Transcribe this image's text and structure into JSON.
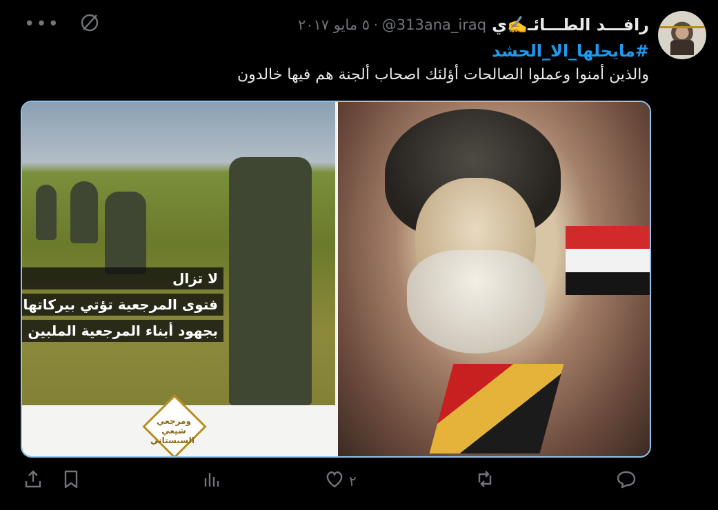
{
  "tweet": {
    "author": {
      "name": "رافـــد الطـــائـ✍️ي",
      "handle": "@313ana_iraq"
    },
    "separator": "·",
    "date": "٥ مايو ٢٠١٧",
    "hashtag": "#مايحلها_الا_الحشد",
    "text": "والذين أمنوا وعملوا الصالحات أؤلئك اصحاب ألجنة هم فيها خالدون",
    "media": {
      "caption_lines": [
        "لا تزال",
        "فتوى المرجعية تؤتي بيركاتها",
        "بجهود أبناء المرجعية الملبين لها"
      ],
      "logo_text": "ومرجعي شيعي السيستاني"
    },
    "metrics": {
      "likes": "٢"
    },
    "icons": {
      "more": "more-icon",
      "grok": "grok-icon",
      "reply": "reply-icon",
      "retweet": "retweet-icon",
      "like": "heart-icon",
      "views": "analytics-icon",
      "bookmark": "bookmark-icon",
      "share": "share-icon"
    },
    "colors": {
      "background": "#000000",
      "text": "#e7e9ea",
      "muted": "#71767b",
      "link": "#1d9bf0"
    }
  }
}
